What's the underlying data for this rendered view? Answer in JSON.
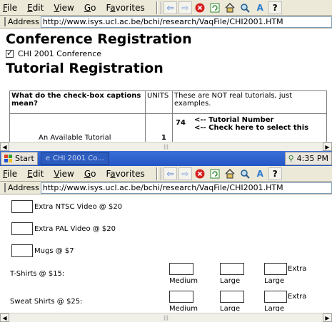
{
  "menus": [
    "File",
    "Edit",
    "View",
    "Go",
    "Favorites"
  ],
  "menu_underlines": [
    "F",
    "E",
    "V",
    "G",
    "a"
  ],
  "help_label": "?",
  "address_label": "Address",
  "url1": "http://www.isys.ucl.ac.be/bchi/research/VaqFile/CHI2001.HTM",
  "url2": "http://www.isys.ucl.ac.be/bchi/research/VaqFile/CHI2001.HTM",
  "conference": {
    "title": "Conference Registration",
    "option_label": "CHI 2001 Conference"
  },
  "tutorial": {
    "title": "Tutorial Registration",
    "col1_header": "What do the check-box captions mean?",
    "col2_header": "UNITS",
    "col3_header": "These are NOT real tutorials, just examples.",
    "row_name": "An Available Tutorial",
    "row_units": "1",
    "row_number": "74",
    "caption_number": "<-- Tutorial Number",
    "caption_select": "<-- Check here to select this"
  },
  "taskbar": {
    "start_label": "Start",
    "task_label": "CHI 2001 Co...",
    "clock": "4:35 PM"
  },
  "extras": [
    {
      "label": "Extra NTSC Video @ $20"
    },
    {
      "label": "Extra PAL Video @ $20"
    },
    {
      "label": "Mugs @ $7"
    }
  ],
  "shirts": [
    {
      "label": "T-Shirts @ $15:",
      "sizes": [
        "Medium",
        "Large",
        "Large"
      ],
      "extra": "Extra"
    },
    {
      "label": "Sweat Shirts @ $25:",
      "sizes": [
        "Medium",
        "Large",
        "Large"
      ],
      "extra": "Extra"
    }
  ],
  "colors": {
    "taskbar": "#2456c6",
    "chrome": "#ece9d8",
    "stop_icon": "#d42020"
  }
}
